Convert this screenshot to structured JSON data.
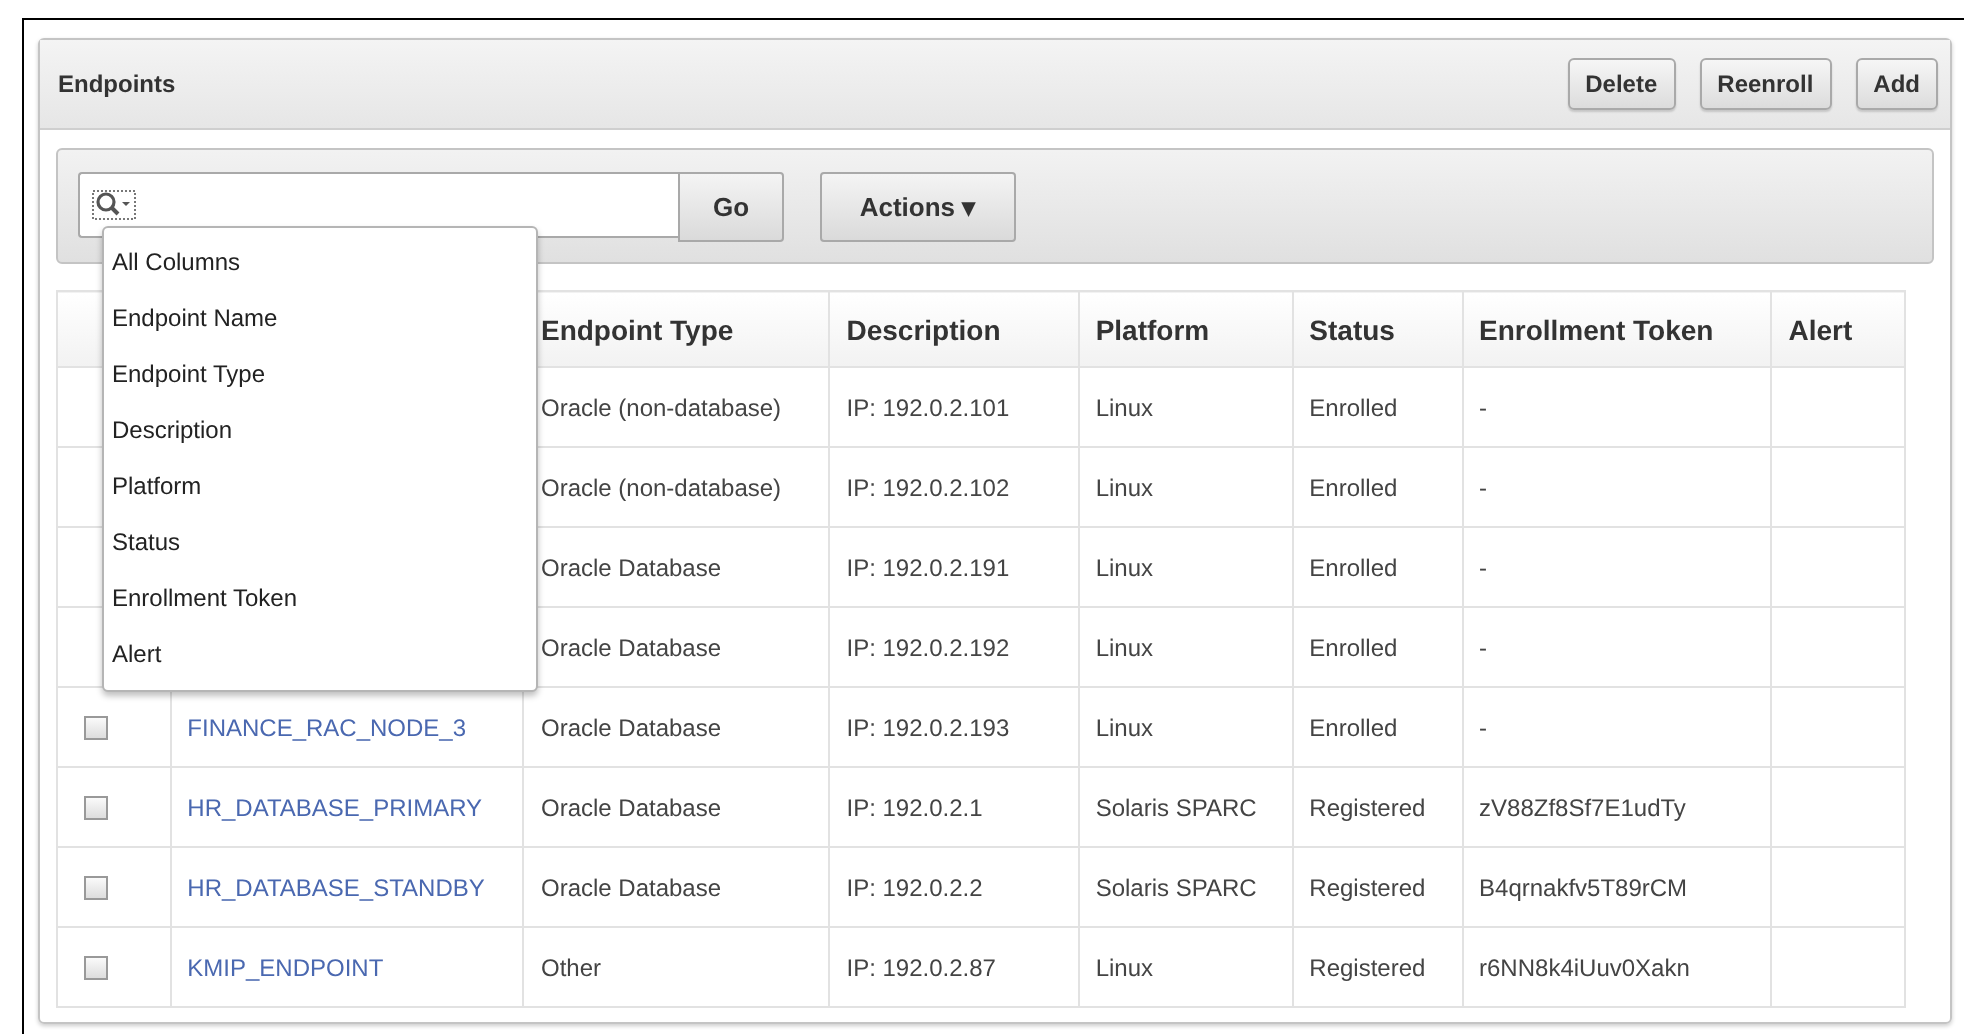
{
  "panel": {
    "title": "Endpoints",
    "buttons": [
      "Delete",
      "Reenroll",
      "Add"
    ]
  },
  "toolbar": {
    "go_button": "Go",
    "actions_button": "Actions ▾",
    "column_menu": {
      "expanded": true,
      "items": [
        "All Columns",
        "Endpoint Name",
        "Endpoint Type",
        "Description",
        "Platform",
        "Status",
        "Enrollment Token",
        "Alert"
      ]
    }
  },
  "table": {
    "columns": [
      "Endpoint Type",
      "Description",
      "Platform",
      "Status",
      "Enrollment Token",
      "Alert"
    ],
    "rows": [
      {
        "type": "Oracle (non-database)",
        "description": "IP: 192.0.2.101",
        "platform": "Linux",
        "status": "Enrolled",
        "token": "-"
      },
      {
        "type": "Oracle (non-database)",
        "description": "IP: 192.0.2.102",
        "platform": "Linux",
        "status": "Enrolled",
        "token": "-"
      },
      {
        "type": "Oracle Database",
        "description": "IP: 192.0.2.191",
        "platform": "Linux",
        "status": "Enrolled",
        "token": "-"
      },
      {
        "type": "Oracle Database",
        "description": "IP: 192.0.2.192",
        "platform": "Linux",
        "status": "Enrolled",
        "token": "-"
      },
      {
        "checked": false,
        "name": "FINANCE_RAC_NODE_3",
        "type": "Oracle Database",
        "description": "IP: 192.0.2.193",
        "platform": "Linux",
        "status": "Enrolled",
        "token": "-"
      },
      {
        "checked": false,
        "name": "HR_DATABASE_PRIMARY",
        "type": "Oracle Database",
        "description": "IP: 192.0.2.1",
        "platform": "Solaris SPARC",
        "status": "Registered",
        "token": "zV88Zf8Sf7E1udTy"
      },
      {
        "checked": false,
        "name": "HR_DATABASE_STANDBY",
        "type": "Oracle Database",
        "description": "IP: 192.0.2.2",
        "platform": "Solaris SPARC",
        "status": "Registered",
        "token": "B4qrnakfv5T89rCM"
      },
      {
        "checked": false,
        "name": "KMIP_ENDPOINT",
        "type": "Other",
        "description": "IP: 192.0.2.87",
        "platform": "Linux",
        "status": "Registered",
        "token": "r6NN8k4iUuv0Xakn"
      }
    ]
  }
}
